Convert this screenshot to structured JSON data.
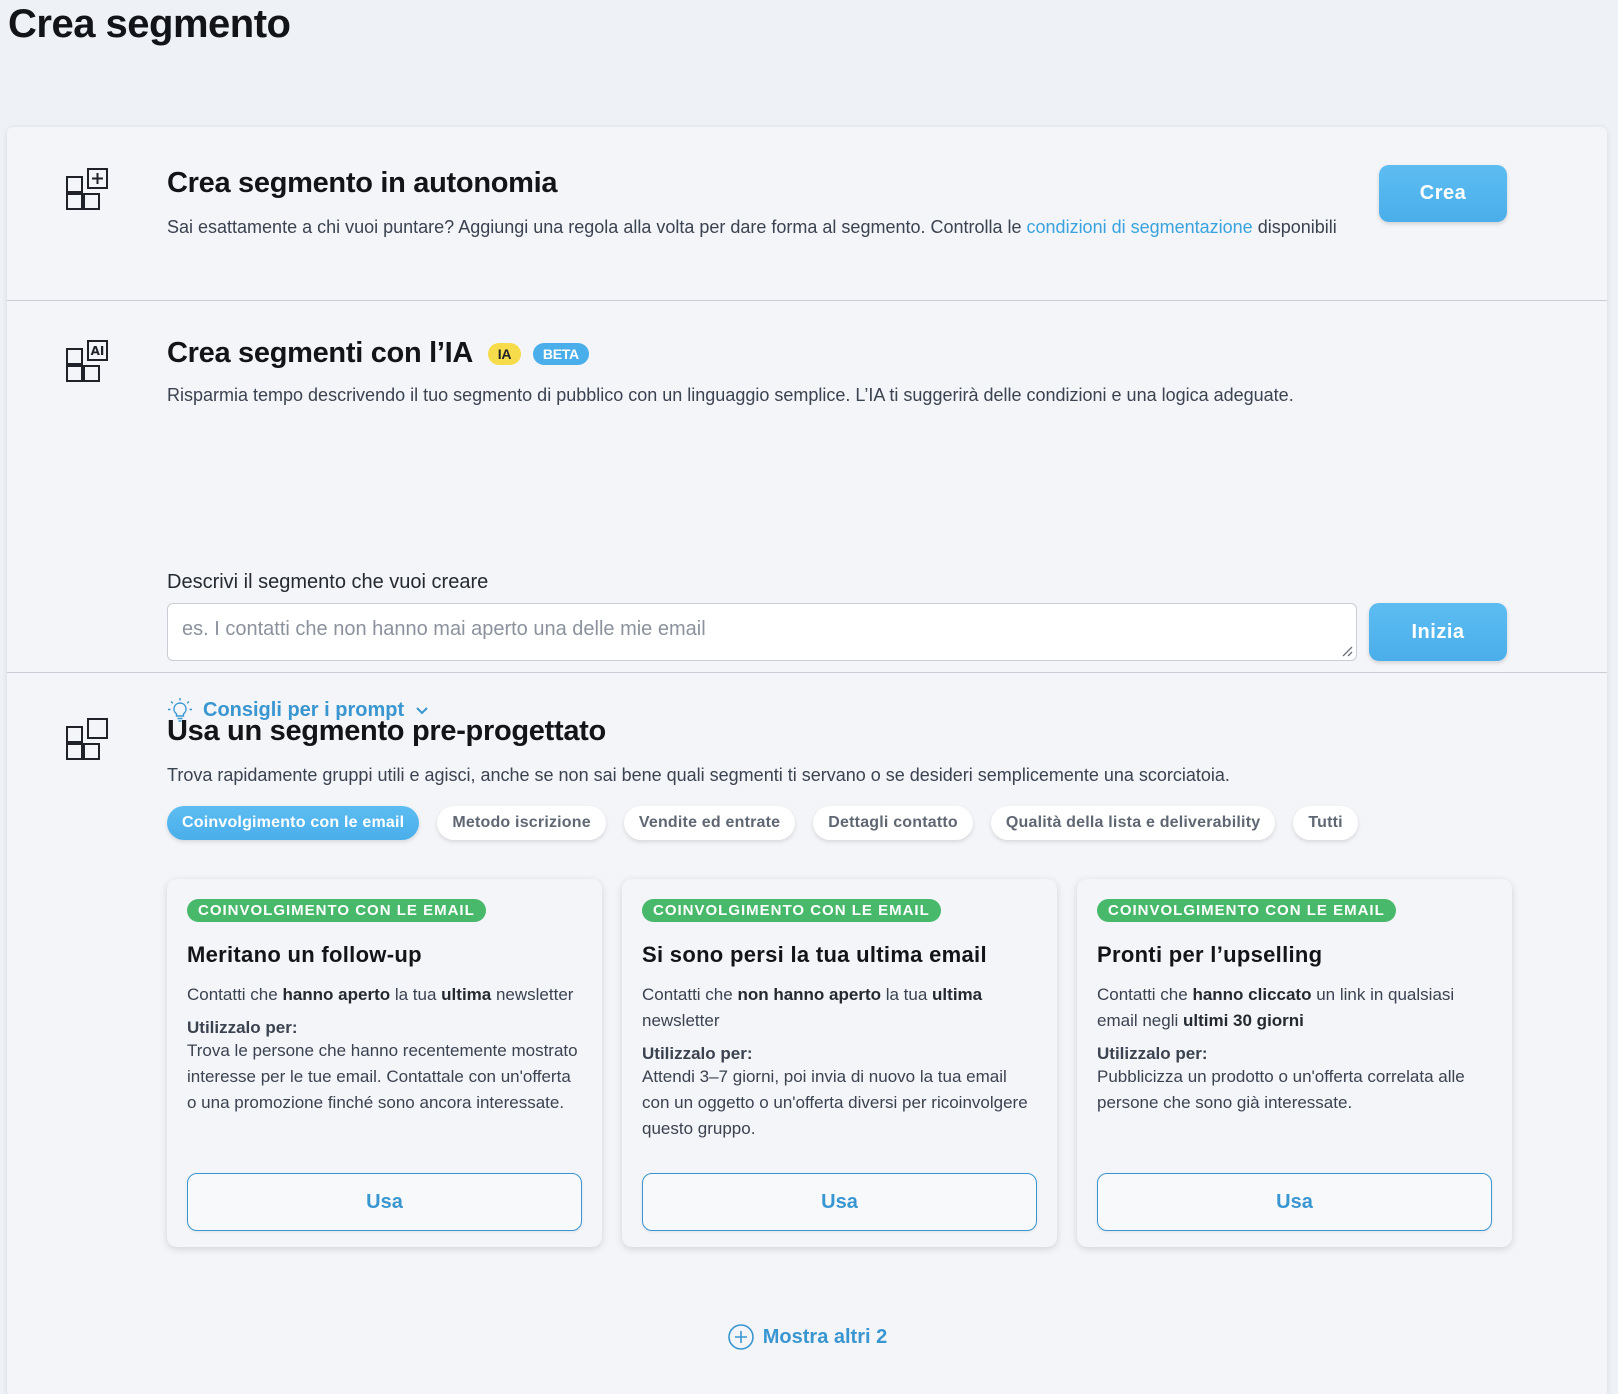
{
  "page": {
    "title": "Crea segmento"
  },
  "manual": {
    "title": "Crea segmento in autonomia",
    "desc_before": "Sai esattamente a chi vuoi puntare? Aggiungi una regola alla volta per dare forma al segmento. Controlla le ",
    "desc_link": "condizioni di segmentazione",
    "desc_after": " disponibili",
    "button": "Crea",
    "icon": "grid-plus-icon"
  },
  "ai": {
    "title": "Crea segmenti con l’IA",
    "badge_ia": "IA",
    "badge_beta": "BETA",
    "desc": "Risparmia tempo descrivendo il tuo segmento di pubblico con un linguaggio semplice. L’IA ti suggerirà delle condizioni e una logica adeguate.",
    "field_label": "Descrivi il segmento che vuoi creare",
    "placeholder": "es. I contatti che non hanno mai aperto una delle mie email",
    "button": "Inizia",
    "tips": "Consigli per i prompt",
    "icon": "grid-ai-icon"
  },
  "prebuilt": {
    "title": "Usa un segmento pre-progettato",
    "desc": "Trova rapidamente gruppi utili e agisci, anche se non sai bene quali segmenti ti servano o se desideri semplicemente una scorciatoia.",
    "icon": "grid-square-icon",
    "filters": [
      {
        "label": "Coinvolgimento con le email",
        "active": true
      },
      {
        "label": "Metodo iscrizione",
        "active": false
      },
      {
        "label": "Vendite ed entrate",
        "active": false
      },
      {
        "label": "Dettagli contatto",
        "active": false
      },
      {
        "label": "Qualità della lista e deliverability",
        "active": false
      },
      {
        "label": "Tutti",
        "active": false
      }
    ],
    "use_for_label": "Utilizzalo per:",
    "cards": [
      {
        "tag": "COINVOLGIMENTO CON LE EMAIL",
        "title": "Meritano un follow-up",
        "d1": "Contatti che ",
        "d2": "hanno aperto",
        "d3": " la tua ",
        "d4": "ultima",
        "d5": " newsletter",
        "use": "Trova le persone che hanno recentemente mostrato interesse per le tue email. Contattale con un'offerta o una promozione finché sono ancora interessate.",
        "button": "Usa"
      },
      {
        "tag": "COINVOLGIMENTO CON LE EMAIL",
        "title": "Si sono persi la tua ultima email",
        "d1": "Contatti che ",
        "d2": "non hanno aperto",
        "d3": " la tua ",
        "d4": "ultima",
        "d5": " newsletter",
        "use": "Attendi 3–7 giorni, poi invia di nuovo la tua email con un oggetto o un'offerta diversi per ricoinvolgere questo gruppo.",
        "button": "Usa"
      },
      {
        "tag": "COINVOLGIMENTO CON LE EMAIL",
        "title": "Pronti per l’upselling",
        "d1": "Contatti che ",
        "d2": "hanno cliccato",
        "d3": " un link in qualsiasi email negli ",
        "d4": "ultimi 30 giorni",
        "d5": "",
        "use": "Pubblicizza un prodotto o un'offerta correlata alle persone che sono già interessate.",
        "button": "Usa"
      }
    ],
    "show_more": "Mostra altri 2"
  },
  "colors": {
    "accent": "#4aaeea",
    "link": "#3aa3dd",
    "tag_green": "#48b96a",
    "badge_yellow": "#f6dc4a"
  }
}
